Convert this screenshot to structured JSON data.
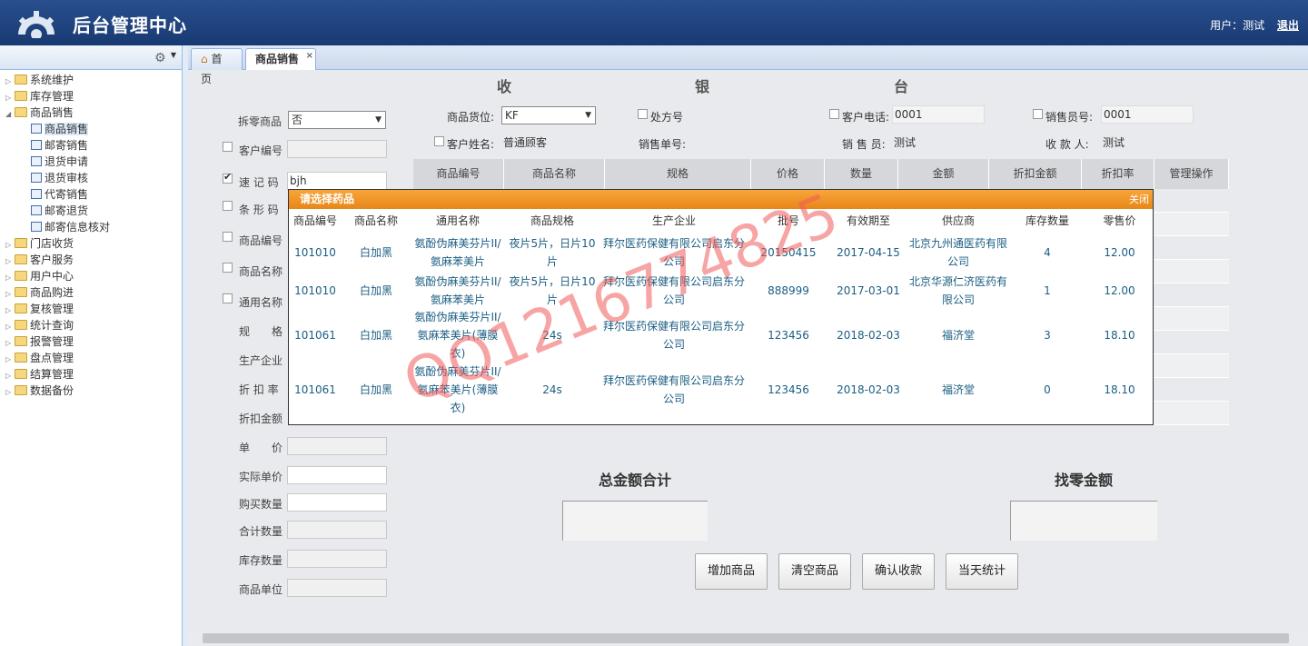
{
  "header": {
    "title": "后台管理中心",
    "user_label": "用户：测试",
    "logout": "退出"
  },
  "sidebar": {
    "tree": [
      {
        "label": "系统维护",
        "type": "folder",
        "expanded": false
      },
      {
        "label": "库存管理",
        "type": "folder",
        "expanded": false
      },
      {
        "label": "商品销售",
        "type": "folder",
        "expanded": true
      },
      {
        "label": "商品销售",
        "type": "leaf",
        "selected": true
      },
      {
        "label": "邮寄销售",
        "type": "leaf"
      },
      {
        "label": "退货申请",
        "type": "leaf"
      },
      {
        "label": "退货审核",
        "type": "leaf"
      },
      {
        "label": "代寄销售",
        "type": "leaf"
      },
      {
        "label": "邮寄退货",
        "type": "leaf"
      },
      {
        "label": "邮寄信息核对",
        "type": "leaf"
      },
      {
        "label": "门店收货",
        "type": "folder",
        "expanded": false
      },
      {
        "label": "客户服务",
        "type": "folder",
        "expanded": false
      },
      {
        "label": "用户中心",
        "type": "folder",
        "expanded": false
      },
      {
        "label": "商品购进",
        "type": "folder",
        "expanded": false
      },
      {
        "label": "复核管理",
        "type": "folder",
        "expanded": false
      },
      {
        "label": "统计查询",
        "type": "folder",
        "expanded": false
      },
      {
        "label": "报警管理",
        "type": "folder",
        "expanded": false
      },
      {
        "label": "盘点管理",
        "type": "folder",
        "expanded": false
      },
      {
        "label": "结算管理",
        "type": "folder",
        "expanded": false
      },
      {
        "label": "数据备份",
        "type": "folder",
        "expanded": false
      }
    ]
  },
  "tabs": {
    "home": "首页",
    "sales": "商品销售",
    "close": "×"
  },
  "cashier": {
    "c1": "收",
    "c2": "银",
    "c3": "台"
  },
  "left_form": {
    "split": "拆零商品",
    "split_value": "否",
    "customer_no": "客户编号",
    "quick_code": "速 记 码",
    "quick_code_value": "bjh",
    "barcode": "条 形 码",
    "product_no": "商品编号",
    "product_name": "商品名称",
    "generic_name": "通用名称",
    "spec": "规　　格",
    "manufacturer": "生产企业",
    "discount_rate": "折 扣 率",
    "discount_amount": "折扣金额",
    "unit_price": "单　　价",
    "actual_price": "实际单价",
    "quantity": "购买数量",
    "total_qty": "合计数量",
    "stock_qty": "库存数量",
    "unit": "商品单位"
  },
  "top_form": {
    "location": "商品货位:",
    "location_value": "KF",
    "prescription": "处方号",
    "phone": "客户电话:",
    "phone_value": "0001",
    "salesman_no": "销售员号:",
    "salesman_no_value": "0001",
    "customer_name": "客户姓名:",
    "customer_name_value": "普通顾客",
    "sale_no": "销售单号:",
    "salesman": "销 售 员:",
    "salesman_value": "测试",
    "cashier": "收 款 人:",
    "cashier_value": "测试"
  },
  "grid_columns": [
    "商品编号",
    "商品名称",
    "规格",
    "价格",
    "数量",
    "金额",
    "折扣金额",
    "折扣率",
    "管理操作"
  ],
  "popup": {
    "title": "请选择药品",
    "close": "关闭",
    "columns": [
      "商品编号",
      "商品名称",
      "通用名称",
      "商品规格",
      "生产企业",
      "批号",
      "有效期至",
      "供应商",
      "库存数量",
      "零售价"
    ],
    "rows": [
      {
        "code": "101010",
        "name": "白加黑",
        "generic": "氨酚伪麻美芬片II/氨麻苯美片",
        "spec": "夜片5片，日片10片",
        "maker": "拜尔医药保健有限公司启东分公司",
        "batch": "20150415",
        "expiry": "2017-04-15",
        "supplier": "北京九州通医药有限公司",
        "stock": "4",
        "price": "12.00"
      },
      {
        "code": "101010",
        "name": "白加黑",
        "generic": "氨酚伪麻美芬片II/氨麻苯美片",
        "spec": "夜片5片，日片10片",
        "maker": "拜尔医药保健有限公司启东分公司",
        "batch": "888999",
        "expiry": "2017-03-01",
        "supplier": "北京华源仁济医药有限公司",
        "stock": "1",
        "price": "12.00"
      },
      {
        "code": "101061",
        "name": "白加黑",
        "generic": "氨酚伪麻美芬片II/氨麻苯美片(薄膜衣)",
        "spec": "24s",
        "maker": "拜尔医药保健有限公司启东分公司",
        "batch": "123456",
        "expiry": "2018-02-03",
        "supplier": "福济堂",
        "stock": "3",
        "price": "18.10"
      },
      {
        "code": "101061",
        "name": "白加黑",
        "generic": "氨酚伪麻美芬片II/氨麻苯美片(薄膜衣)",
        "spec": "24s",
        "maker": "拜尔医药保健有限公司启东分公司",
        "batch": "123456",
        "expiry": "2018-02-03",
        "supplier": "福济堂",
        "stock": "0",
        "price": "18.10"
      }
    ]
  },
  "totals": {
    "total": "总金额合计",
    "change": "找零金额"
  },
  "buttons": {
    "add": "增加商品",
    "clear": "清空商品",
    "confirm": "确认收款",
    "today": "当天统计"
  },
  "watermark": "QQ1216774825"
}
